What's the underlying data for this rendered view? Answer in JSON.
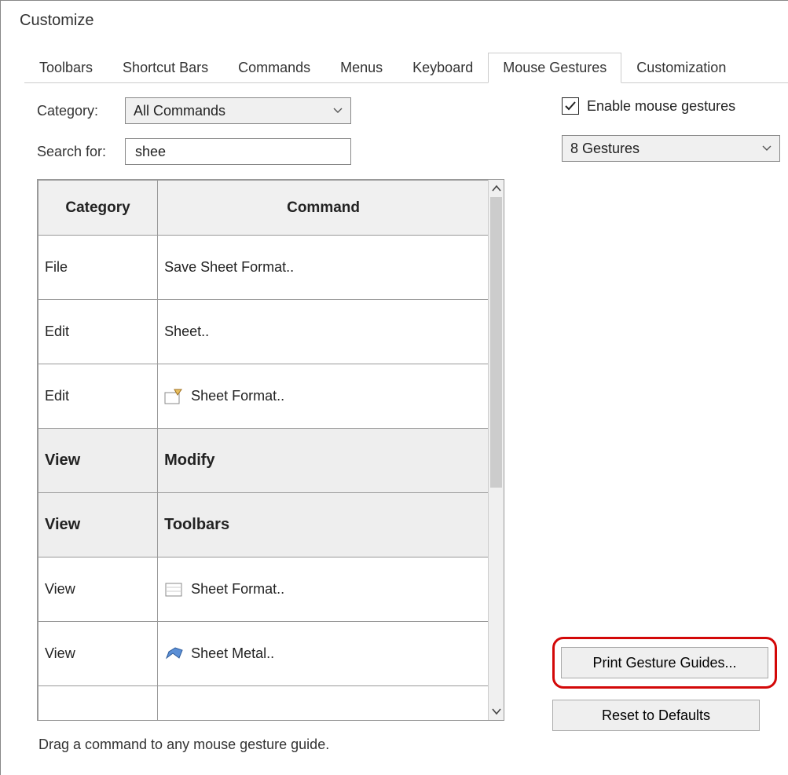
{
  "window": {
    "title": "Customize"
  },
  "tabs": {
    "items": [
      {
        "label": "Toolbars"
      },
      {
        "label": "Shortcut Bars"
      },
      {
        "label": "Commands"
      },
      {
        "label": "Menus"
      },
      {
        "label": "Keyboard"
      },
      {
        "label": "Mouse Gestures"
      },
      {
        "label": "Customization"
      }
    ],
    "active": 5
  },
  "category": {
    "label": "Category:",
    "value": "All Commands"
  },
  "search": {
    "label": "Search for:",
    "value": "shee"
  },
  "enable_gestures": {
    "label": "Enable mouse gestures",
    "checked": true
  },
  "gesture_count": {
    "value": "8 Gestures"
  },
  "table": {
    "headers": {
      "category": "Category",
      "command": "Command"
    },
    "rows": [
      {
        "category": "File",
        "command": "Save Sheet Format..",
        "icon": null,
        "group": false
      },
      {
        "category": "Edit",
        "command": "Sheet..",
        "icon": null,
        "group": false
      },
      {
        "category": "Edit",
        "command": "Sheet Format..",
        "icon": "page-edit-icon",
        "group": false
      },
      {
        "category": "View",
        "command": "Modify",
        "icon": null,
        "group": true
      },
      {
        "category": "View",
        "command": "Toolbars",
        "icon": null,
        "group": true
      },
      {
        "category": "View",
        "command": "Sheet Format..",
        "icon": "page-icon",
        "group": false
      },
      {
        "category": "View",
        "command": "Sheet Metal..",
        "icon": "sheetmetal-icon",
        "group": false
      }
    ]
  },
  "hint": "Drag a command to any mouse gesture guide.",
  "buttons": {
    "print": "Print Gesture Guides...",
    "reset": "Reset to Defaults"
  }
}
